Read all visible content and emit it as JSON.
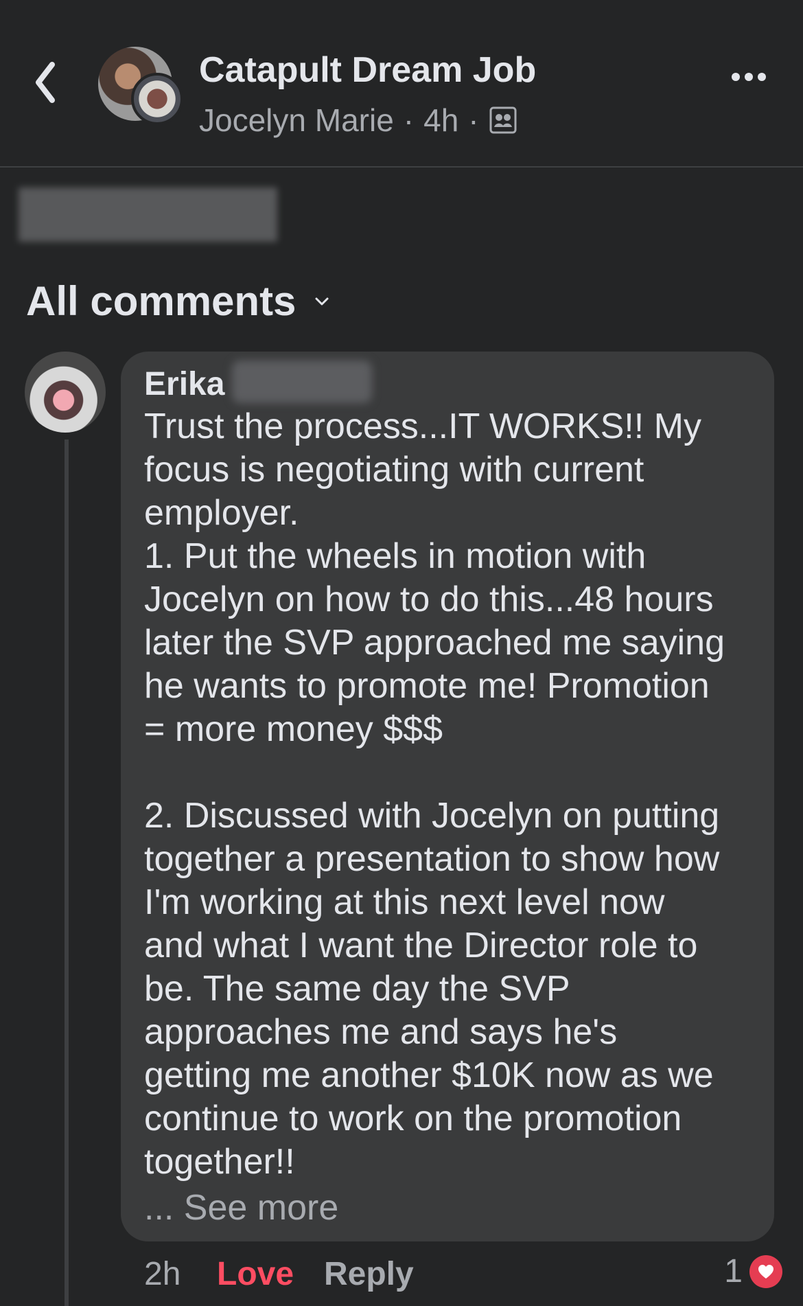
{
  "header": {
    "title": "Catapult Dream Job",
    "author": "Jocelyn Marie",
    "separator": "·",
    "time": "4h",
    "icons": {
      "back": "chevron-left-icon",
      "group": "group-icon",
      "more": "more-options-icon"
    }
  },
  "comments_header": {
    "label": "All comments"
  },
  "comment": {
    "author": "Erika",
    "body": "Trust the process...IT WORKS!! My\nfocus is negotiating with current\nemployer.\n1. Put the wheels in motion with\nJocelyn on how to do this...48 hours\nlater the SVP approached me saying\nhe wants to promote me! Promotion\n= more money $$$\n\n2. Discussed with Jocelyn on putting\ntogether a presentation to show how\nI'm working at this next level now\nand what I want the Director role to\nbe. The same day the SVP\napproaches me and says he's\ngetting me another $10K now as we\ncontinue to work on the promotion\ntogether!!",
    "see_more": "... See more",
    "time": "2h",
    "love_label": "Love",
    "reply_label": "Reply",
    "reaction_count": "1",
    "reaction_icon": "heart-icon"
  },
  "colors": {
    "background": "#242526",
    "bubble": "#3a3b3c",
    "text": "#e4e6eb",
    "muted": "#a8abb0",
    "love": "#ff4d62",
    "heart": "#e53d52"
  }
}
